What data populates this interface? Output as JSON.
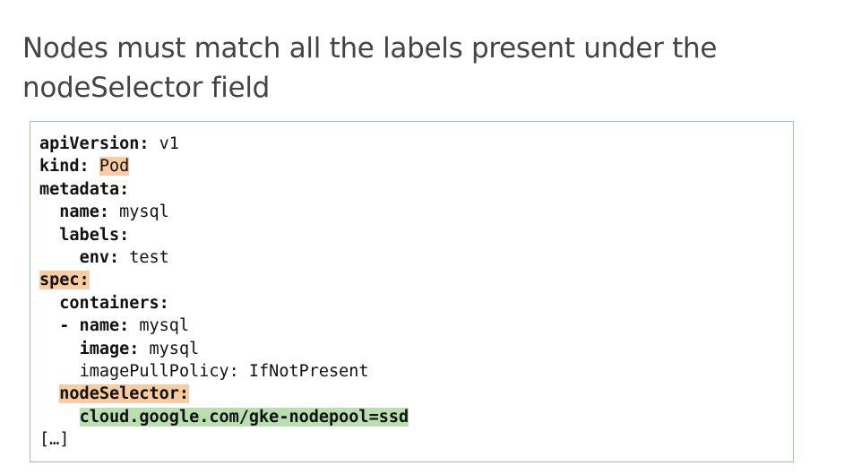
{
  "title": {
    "line1": "Nodes must match all the labels present under the",
    "line2": "nodeSelector field"
  },
  "colors": {
    "title_text": "#444444",
    "box_border": "#8fcf97",
    "highlight_orange": "#f9cba0",
    "highlight_green": "#b9dfb0"
  },
  "code": {
    "apiVersion_key": "apiVersion:",
    "apiVersion_value": " v1",
    "kind_key": "kind:",
    "kind_value": "Pod",
    "metadata_key": "metadata:",
    "name_key": "name:",
    "name_value": " mysql",
    "labels_key": "labels:",
    "env_key": "env:",
    "env_value": " test",
    "spec_key": "spec:",
    "containers_key": "containers:",
    "container_name_key": "- name:",
    "container_name_value": " mysql",
    "image_key": "image:",
    "image_value": " mysql",
    "imagePullPolicy_line": "imagePullPolicy: IfNotPresent",
    "nodeSelector_key": "nodeSelector:",
    "nodeSelector_label": "cloud.google.com/gke-nodepool=ssd",
    "ellipsis": "[…]"
  }
}
